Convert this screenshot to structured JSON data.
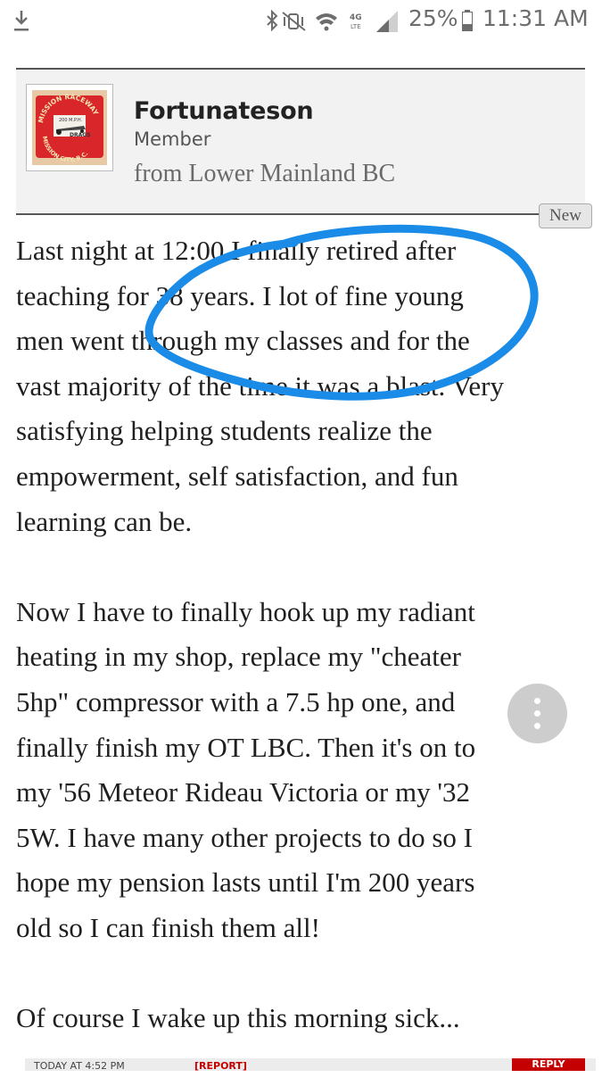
{
  "status_bar": {
    "battery_percent": "25%",
    "time": "11:31 AM",
    "icons": [
      "download-icon",
      "bluetooth-icon",
      "vibrate-icon",
      "wifi-icon",
      "4g-lte-icon",
      "signal-icon",
      "battery-icon"
    ]
  },
  "post": {
    "author": {
      "username": "Fortunateson",
      "title": "Member",
      "location": "from Lower Mainland BC",
      "avatar_text": [
        "MISSION RACEWAY",
        "200 M.P.H.",
        "DRAGS",
        "MISSION CITY, B.C."
      ]
    },
    "new_badge": "New",
    "paragraphs": [
      {
        "lines": [
          "Last night at 12:00 I finally retired after",
          "teaching for 38 years. I lot of fine young",
          "men went through my classes and for the",
          "vast majority of the time it was a blast. Very",
          "satisfying helping students realize the",
          "empowerment, self satisfaction, and fun",
          "learning can be."
        ]
      },
      {
        "lines": [
          "Now I have to finally hook up my radiant",
          "heating in my shop, replace my \"cheater",
          "5hp\" compressor with a 7.5 hp one, and",
          "finally finish my OT LBC. Then it's on to",
          "my '56 Meteor Rideau Victoria or my '32",
          "5W. I have many other projects to do so I",
          "hope my pension lasts until I'm 200 years",
          "old so I can finish them all!"
        ]
      },
      {
        "lines": [
          "Of course I wake up this morning sick..."
        ]
      }
    ]
  },
  "colors": {
    "annotation_blue": "#1a8ce8",
    "header_bg": "#f2f2f2",
    "report_red": "#c40000"
  },
  "bottom_bar": {
    "date": "TODAY AT 4:52 PM",
    "report": "[REPORT]",
    "reply": "REPLY"
  }
}
